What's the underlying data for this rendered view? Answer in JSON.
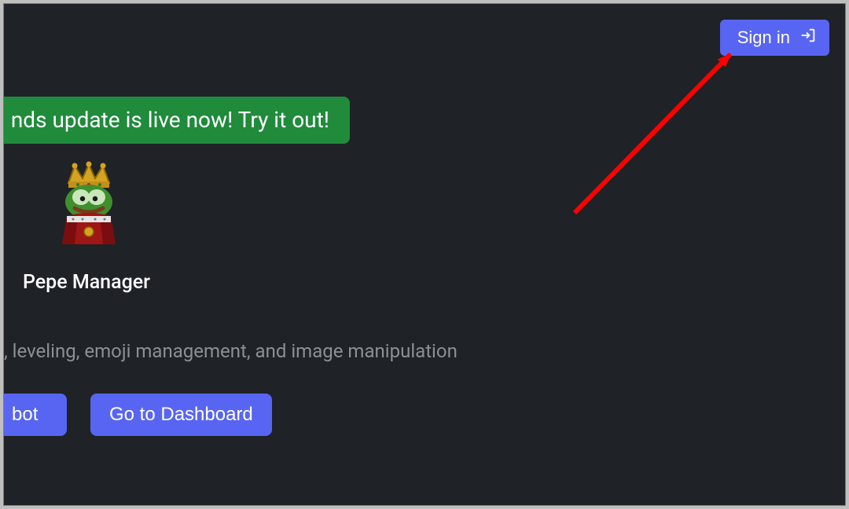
{
  "header": {
    "signin_label": "Sign in"
  },
  "banner": {
    "text": "nds update is live now! Try it out!"
  },
  "app": {
    "title": "Pepe Manager",
    "subtitle": ", leveling, emoji management, and image manipulation",
    "logo_name": "pepe-king"
  },
  "actions": {
    "invite_bot_label": "bot",
    "dashboard_label": "Go to Dashboard"
  },
  "colors": {
    "accent": "#5865f2",
    "banner_bg": "#1f8b3b",
    "page_bg": "#1f2226"
  },
  "annotation": {
    "arrow_color": "#ff0000",
    "points_to": "sign-in-button"
  }
}
